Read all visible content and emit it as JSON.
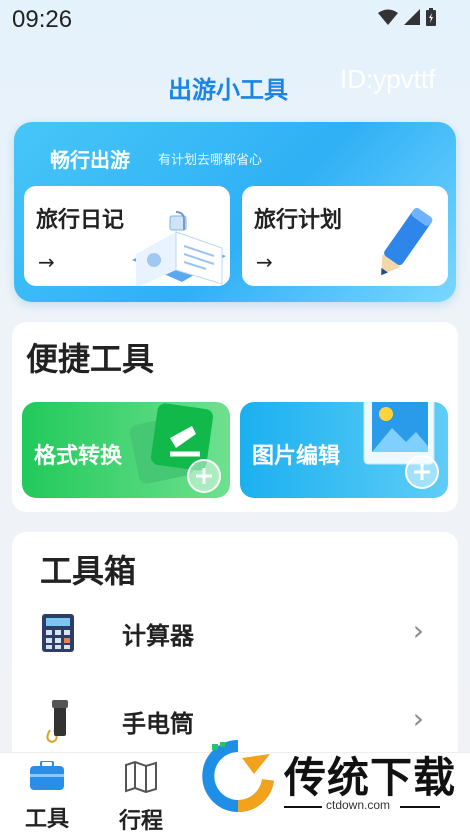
{
  "status_bar": {
    "time": "09:26"
  },
  "header": {
    "app_title": "出游小工具",
    "user_id": "ID:ypvttf"
  },
  "travel_section": {
    "heading": "畅行出游",
    "subtitle": "有计划去哪都省心",
    "cards": [
      {
        "label": "旅行日记",
        "arrow": "→",
        "icon": "notebook-icon"
      },
      {
        "label": "旅行计划",
        "arrow": "→",
        "icon": "pencil-icon"
      }
    ]
  },
  "quick_tools": {
    "title": "便捷工具",
    "tiles": [
      {
        "label": "格式转换",
        "icon": "convert-icon",
        "color": "#2ed06a"
      },
      {
        "label": "图片编辑",
        "icon": "image-icon",
        "color": "#2ab8f3"
      }
    ]
  },
  "toolbox": {
    "title": "工具箱",
    "items": [
      {
        "label": "计算器",
        "icon": "calculator-icon",
        "chevron": "›"
      },
      {
        "label": "手电筒",
        "icon": "flashlight-icon",
        "chevron": "›"
      }
    ]
  },
  "bottom_nav": {
    "items": [
      {
        "label": "工具",
        "icon": "toolbox-icon"
      },
      {
        "label": "行程",
        "icon": "map-icon"
      }
    ]
  },
  "watermark": {
    "brand": "传统下载",
    "url": "ctdown.com"
  },
  "colors": {
    "accent": "#1a85e6",
    "travel_card": "#2fb0f5"
  }
}
